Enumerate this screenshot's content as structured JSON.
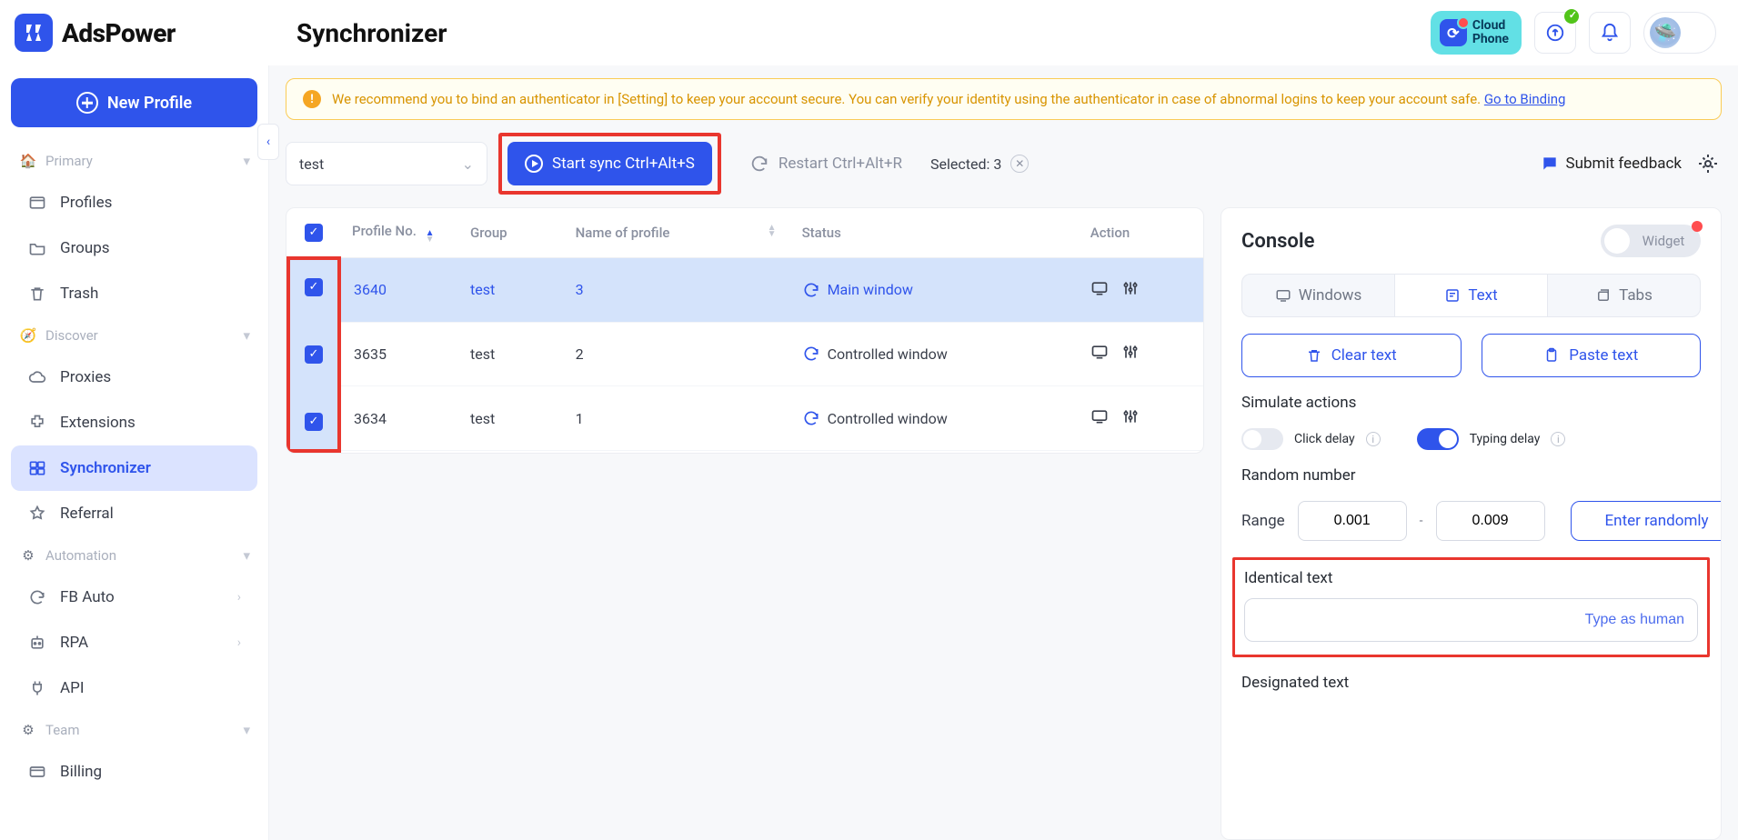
{
  "brand": "AdsPower",
  "pageTitle": "Synchronizer",
  "topActions": {
    "cloudPhoneLine1": "Cloud",
    "cloudPhoneLine2": "Phone"
  },
  "sidebar": {
    "newProfile": "New Profile",
    "sections": {
      "primary": {
        "title": "Primary",
        "items": [
          "Profiles",
          "Groups",
          "Trash"
        ]
      },
      "discover": {
        "title": "Discover",
        "items": [
          "Proxies",
          "Extensions",
          "Synchronizer",
          "Referral"
        ]
      },
      "automation": {
        "title": "Automation",
        "items": [
          "FB Auto",
          "RPA",
          "API"
        ]
      },
      "team": {
        "title": "Team",
        "items": [
          "Billing"
        ]
      }
    }
  },
  "alert": {
    "text": "We recommend you to bind an authenticator in [Setting] to keep your account secure. You can verify your identity using the authenticator in case of abnormal logins to keep your account safe. ",
    "link": "Go to Binding"
  },
  "toolbar": {
    "groupDropdown": "test",
    "startSync": "Start sync Ctrl+Alt+S",
    "restart": "Restart Ctrl+Alt+R",
    "selectedLabel": "Selected: ",
    "selectedCount": "3",
    "feedback": "Submit feedback"
  },
  "table": {
    "headers": {
      "profileNo": "Profile No.",
      "group": "Group",
      "name": "Name of profile",
      "status": "Status",
      "action": "Action"
    },
    "rows": [
      {
        "profile": "3640",
        "group": "test",
        "name": "3",
        "status": "Main window",
        "selected": true
      },
      {
        "profile": "3635",
        "group": "test",
        "name": "2",
        "status": "Controlled window",
        "selected": false
      },
      {
        "profile": "3634",
        "group": "test",
        "name": "1",
        "status": "Controlled window",
        "selected": false
      }
    ]
  },
  "console": {
    "title": "Console",
    "widget": "Widget",
    "tabs": {
      "windows": "Windows",
      "text": "Text",
      "tabs": "Tabs"
    },
    "clear": "Clear text",
    "paste": "Paste text",
    "simTitle": "Simulate actions",
    "clickDelay": "Click delay",
    "typingDelay": "Typing delay",
    "randomTitle": "Random number",
    "range": "Range",
    "rangeMin": "0.001",
    "rangeMax": "0.009",
    "enterRandom": "Enter randomly",
    "identTitle": "Identical text",
    "identPlaceholder": "Type as human",
    "designTitle": "Designated text"
  }
}
